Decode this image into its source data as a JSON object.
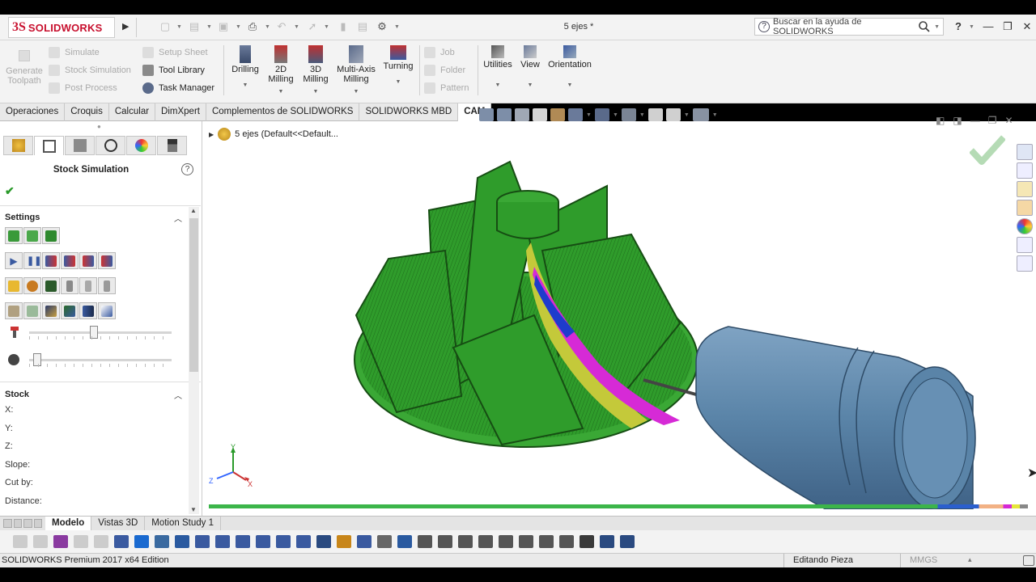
{
  "app": {
    "logo_ds": "3S",
    "logo_text": "SOLIDWORKS",
    "doc_title": "5 ejes *"
  },
  "search": {
    "placeholder": "Buscar en la ayuda de SOLIDWORKS"
  },
  "titlebar": {
    "help": "?",
    "min": "—",
    "restore": "❐",
    "close": "✕"
  },
  "ribbon": {
    "generate_toolpath": "Generate Toolpath",
    "simulate": "Simulate",
    "stock_simulation": "Stock Simulation",
    "post_process": "Post Process",
    "setup_sheet": "Setup Sheet",
    "tool_library": "Tool Library",
    "task_manager": "Task Manager",
    "drilling": "Drilling",
    "milling_2d": "2D Milling",
    "milling_3d": "3D Milling",
    "multiaxis": "Multi-Axis Milling",
    "turning": "Turning",
    "job": "Job",
    "folder": "Folder",
    "pattern": "Pattern",
    "utilities": "Utilities",
    "view": "View",
    "orientation": "Orientation"
  },
  "tabs": [
    "Operaciones",
    "Croquis",
    "Calcular",
    "DimXpert",
    "Complementos de SOLIDWORKS",
    "SOLIDWORKS MBD",
    "CAM"
  ],
  "active_tab": "CAM",
  "panel": {
    "title": "Stock Simulation",
    "help": "?",
    "ok": "✔",
    "settings": "Settings",
    "stock": "Stock",
    "fields": [
      "X:",
      "Y:",
      "Z:",
      "Slope:",
      "Cut by:",
      "Distance:"
    ],
    "tool_speed_fraction": 0.45,
    "detail_fraction": 0.03
  },
  "tree": {
    "label": "5 ejes  (Default<<Default..."
  },
  "triad": {
    "y": "Y",
    "z": "Z",
    "x": "X"
  },
  "simulation_progress": 0.99,
  "bottom_tabs": [
    "Modelo",
    "Vistas 3D",
    "Motion Study 1"
  ],
  "active_bottom_tab": "Modelo",
  "status": {
    "edition": "SOLIDWORKS Premium 2017 x64 Edition",
    "mode": "Editando Pieza",
    "units": "MMGS",
    "units_caret": "▴"
  },
  "colors": {
    "part_green": "#2f9c2b",
    "tool_blue": "#5a84a8",
    "accent_red": "#c8102e"
  }
}
